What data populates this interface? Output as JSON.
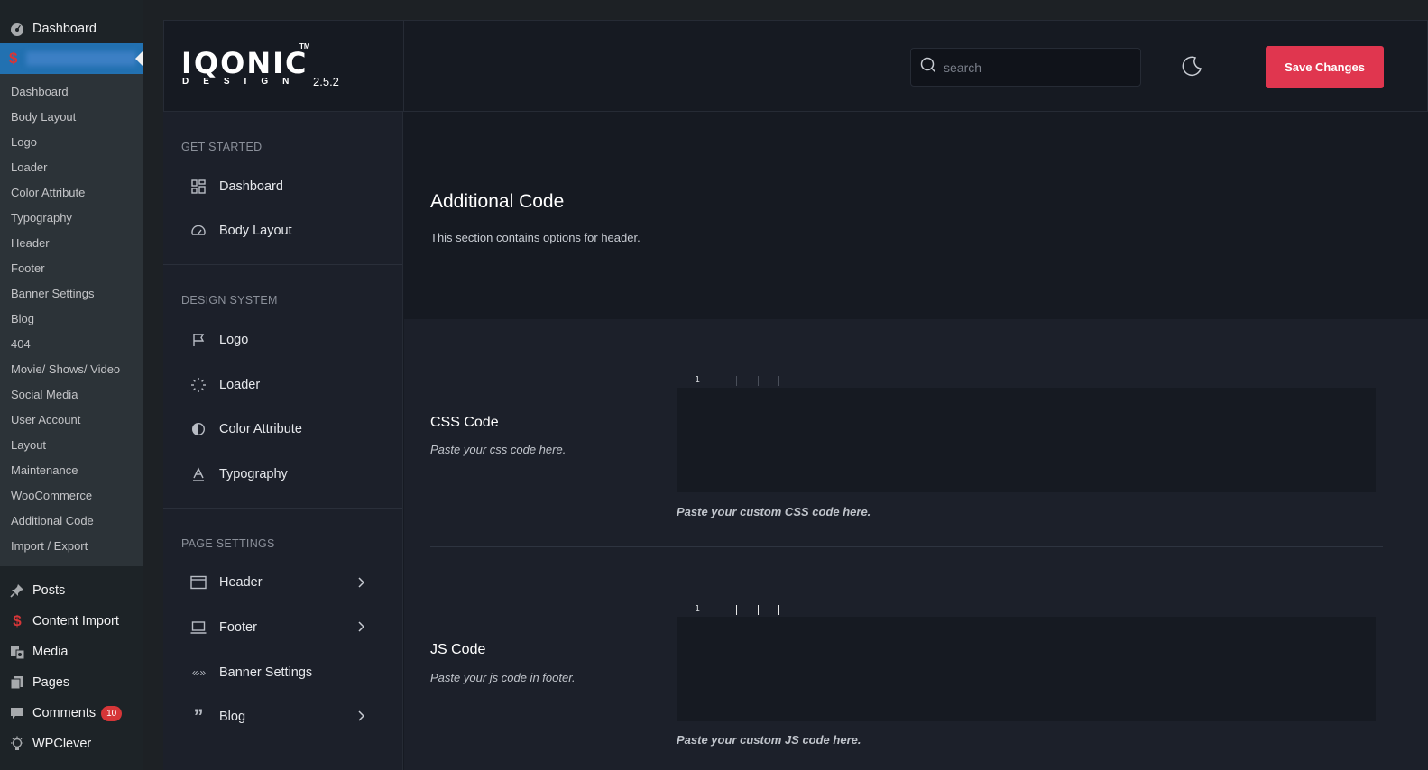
{
  "wp_sidebar": {
    "dashboard_label": "Dashboard",
    "submenu": [
      "Dashboard",
      "Body Layout",
      "Logo",
      "Loader",
      "Color Attribute",
      "Typography",
      "Header",
      "Footer",
      "Banner Settings",
      "Blog",
      "404",
      "Movie/ Shows/ Video",
      "Social Media",
      "User Account",
      "Layout",
      "Maintenance",
      "WooCommerce",
      "Additional Code",
      "Import / Export"
    ],
    "main_items": [
      {
        "label": "Posts",
        "icon": "pin-icon"
      },
      {
        "label": "Content Import",
        "icon": "dollar-icon"
      },
      {
        "label": "Media",
        "icon": "media-icon"
      },
      {
        "label": "Pages",
        "icon": "pages-icon"
      },
      {
        "label": "Comments",
        "icon": "comment-icon",
        "badge": "10"
      },
      {
        "label": "WPClever",
        "icon": "bulb-icon"
      }
    ]
  },
  "header": {
    "logo_text": "IQONIC",
    "logo_tm": "TM",
    "logo_sub": "DESIGN",
    "version": "2.5.2",
    "search_placeholder": "search",
    "save_label": "Save Changes"
  },
  "nav": {
    "sections": [
      {
        "heading": "GET STARTED",
        "items": [
          {
            "label": "Dashboard",
            "icon": "grid-icon",
            "chevron": false
          },
          {
            "label": "Body Layout",
            "icon": "gauge-icon",
            "chevron": false
          }
        ]
      },
      {
        "heading": "DESIGN SYSTEM",
        "items": [
          {
            "label": "Logo",
            "icon": "flag-icon",
            "chevron": false
          },
          {
            "label": "Loader",
            "icon": "spinner-icon",
            "chevron": false
          },
          {
            "label": "Color Attribute",
            "icon": "contrast-icon",
            "chevron": false
          },
          {
            "label": "Typography",
            "icon": "font-icon",
            "chevron": false
          }
        ]
      },
      {
        "heading": "PAGE SETTINGS",
        "items": [
          {
            "label": "Header",
            "icon": "window-icon",
            "chevron": true
          },
          {
            "label": "Footer",
            "icon": "laptop-icon",
            "chevron": true
          },
          {
            "label": "Banner Settings",
            "icon": "code-icon",
            "chevron": false
          },
          {
            "label": "Blog",
            "icon": "quote-icon",
            "chevron": true
          }
        ]
      }
    ]
  },
  "content": {
    "title": "Additional Code",
    "description": "This section contains options for header.",
    "fields": [
      {
        "title": "CSS Code",
        "subtitle": "Paste your css code here.",
        "line": "1",
        "help": "Paste your custom CSS code here."
      },
      {
        "title": "JS Code",
        "subtitle": "Paste your js code in footer.",
        "line": "1",
        "help": "Paste your custom JS code here."
      }
    ]
  },
  "colors": {
    "accent": "#e0364f",
    "wp_active": "#2271b1",
    "panel_bg": "#161a22"
  }
}
